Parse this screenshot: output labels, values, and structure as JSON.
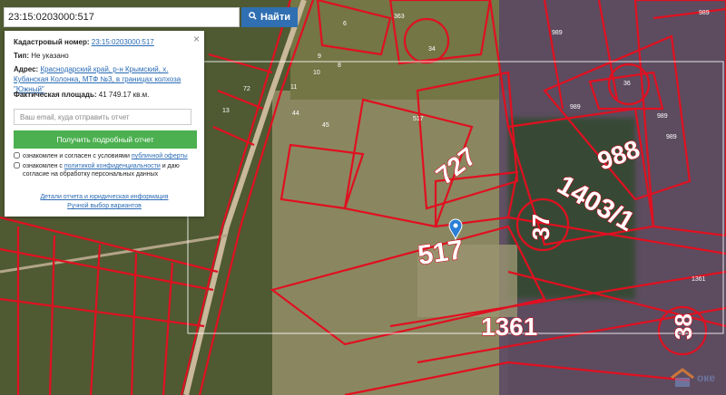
{
  "search": {
    "value": "23:15:0203000:517",
    "button_label": "Найти"
  },
  "info": {
    "cadastral_label": "Кадастровый номер:",
    "cadastral_value": "23:15:0203000:517",
    "type_label": "Тип:",
    "type_value": "Не указано",
    "address_label": "Адрес:",
    "address_value": "Краснодарский край, р-н Крымский, х. Кубанская Колонка, МТФ №3, в границах колхоза \"Южный\"",
    "area_label": "Фактическая площадь:",
    "area_value": "41 749.17 кв.м.",
    "email_placeholder": "Ваш email, куда отправить отчет",
    "report_button": "Получить подробный отчет",
    "consent1_text": "ознакомлен и согласен с условиями ",
    "consent1_link": "публичной оферты",
    "consent2_text": "ознакомлен с ",
    "consent2_link": "политикой конфиденциальности",
    "consent2_text2": " и даю согласие на обработку персональных данных",
    "details_link": "Детали отчета и юридическая информация",
    "manual_link": "Ручной выбор вариантов",
    "close_symbol": "×"
  },
  "map": {
    "parcel_labels": [
      "727",
      "517",
      "988",
      "1403/1",
      "37",
      "1361",
      "38",
      "989",
      "989",
      "989",
      "989",
      "989",
      "363",
      "34",
      "36",
      "517",
      "1361",
      "44",
      "45",
      "6",
      "8",
      "72",
      "9",
      "10",
      "11",
      "13"
    ],
    "colors": {
      "boundary": "#e01020",
      "label_fill": "#ffffff",
      "label_stroke": "#d01020",
      "field": "#6d7448",
      "purple": "#5a3f63"
    }
  },
  "logo": {
    "text": "оке"
  }
}
